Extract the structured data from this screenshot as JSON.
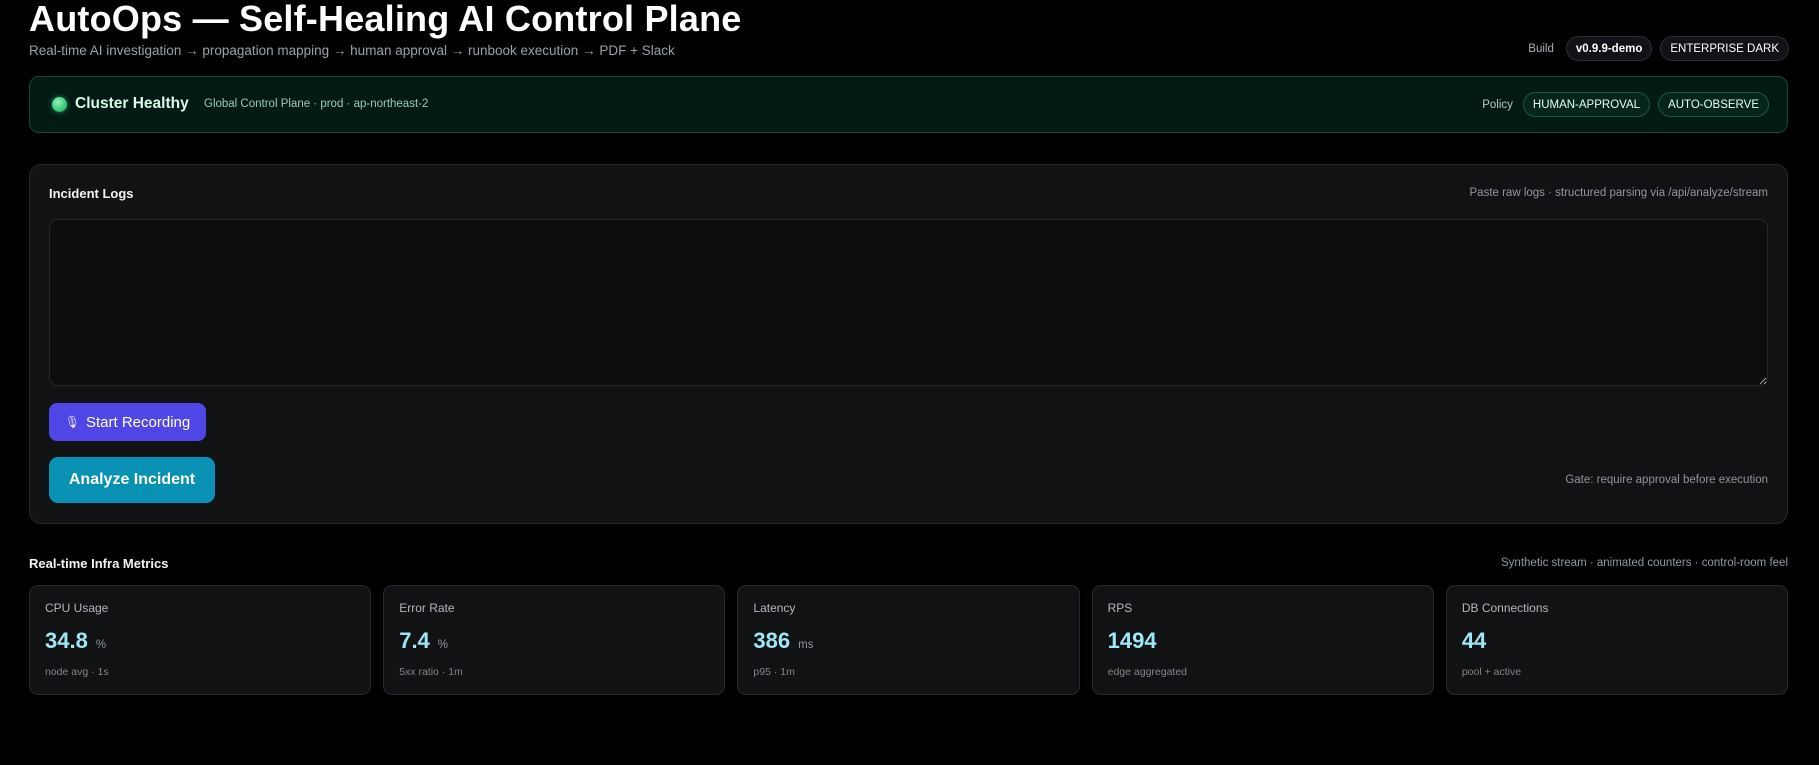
{
  "header": {
    "title": "AutoOps — Self-Healing AI Control Plane",
    "subtitle": "Real-time AI investigation → propagation mapping → human approval → runbook execution → PDF + Slack",
    "build_label": "Build",
    "build_version": "v0.9.9-demo",
    "theme_badge": "ENTERPRISE DARK"
  },
  "status": {
    "title": "Cluster Healthy",
    "detail": "Global Control Plane · prod · ap-northeast-2",
    "policy_label": "Policy",
    "policies": [
      "HUMAN-APPROVAL",
      "AUTO-OBSERVE"
    ],
    "indicator_color": "#3ddc84"
  },
  "incident_logs": {
    "title": "Incident Logs",
    "hint": "Paste raw logs · structured parsing via /api/analyze/stream",
    "textarea_value": "",
    "record_label": "Start Recording",
    "record_icon": "microphone-icon",
    "analyze_label": "Analyze Incident",
    "gate_note": "Gate: require approval before execution"
  },
  "metrics": {
    "title": "Real-time Infra Metrics",
    "hint": "Synthetic stream · animated counters · control-room feel",
    "items": [
      {
        "label": "CPU Usage",
        "value": "34.8",
        "unit": "%",
        "foot": "node avg · 1s"
      },
      {
        "label": "Error Rate",
        "value": "7.4",
        "unit": "%",
        "foot": "5xx ratio · 1m"
      },
      {
        "label": "Latency",
        "value": "386",
        "unit": "ms",
        "foot": "p95 · 1m"
      },
      {
        "label": "RPS",
        "value": "1494",
        "unit": "",
        "foot": "edge aggregated"
      },
      {
        "label": "DB Connections",
        "value": "44",
        "unit": "",
        "foot": "pool + active"
      }
    ]
  },
  "colors": {
    "accent_indigo": "#4f46e5",
    "accent_cyan": "#0891b2",
    "metric_value": "#9ee8f6",
    "status_bg": "#021a14"
  }
}
